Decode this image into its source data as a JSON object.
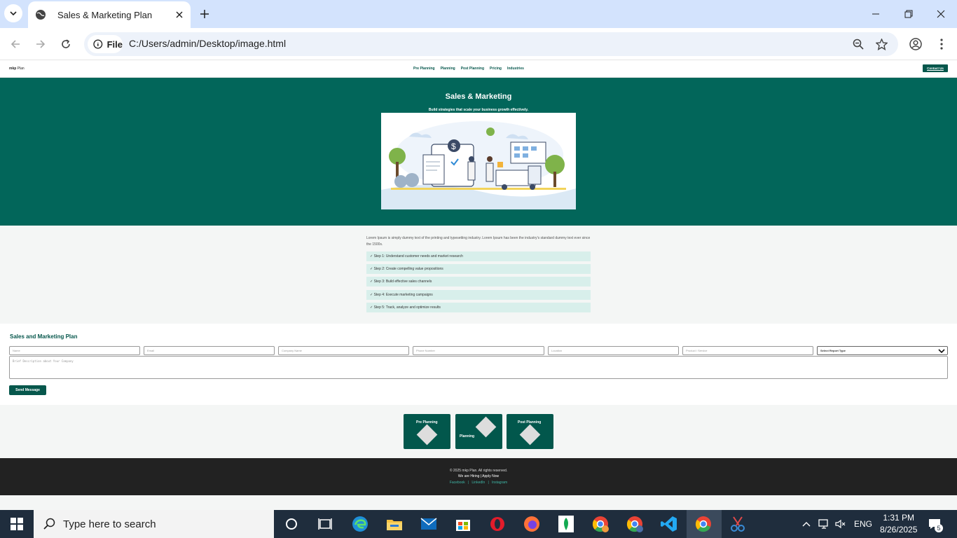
{
  "browser": {
    "tab_title": "Sales & Marketing Plan",
    "site_chip": "File",
    "url": "C:/Users/admin/Desktop/image.html"
  },
  "site": {
    "logo_bold": "mkp",
    "logo_rest": " Plan",
    "nav": [
      "Pre Planning",
      "Planning",
      "Post Planning",
      "Pricing",
      "Industries"
    ],
    "contact_label": "Contact Us",
    "hero_title": "Sales & Marketing",
    "hero_subtitle": "Build strategies that scale your business growth effectively.",
    "lorem": "Lorem Ipsum is simply dummy text of the printing and typesetting industry. Lorem Ipsum has been the industry's standard dummy text ever since the 1500s.",
    "steps": [
      "✓ Step 1: Understand customer needs and market research",
      "✓ Step 2: Create compelling value propositions",
      "✓ Step 3: Build effective sales channels",
      "✓ Step 4: Execute marketing campaigns",
      "✓ Step 5: Track, analyze and optimize results"
    ],
    "form": {
      "title": "Sales and Marketing Plan",
      "placeholders": [
        "Name",
        "Email",
        "Company Name",
        "Phone Number",
        "Location",
        "Product / Service"
      ],
      "select_value": "Select Report Type",
      "textarea_placeholder": "Brief Description about Your Company",
      "send_label": "Send Message"
    },
    "cards": [
      "Pre Planning",
      "Planning",
      "Post Planning"
    ],
    "footer": {
      "copyright": "© 2025 mkp Plan. All rights reserved.",
      "hiring": "We are Hiring | Apply Now",
      "social": "Facebook   |   LinkedIn   |   Instagram"
    }
  },
  "taskbar": {
    "search_placeholder": "Type here to search",
    "language": "ENG",
    "time": "1:31 PM",
    "date": "8/26/2025",
    "notification_count": "5"
  }
}
